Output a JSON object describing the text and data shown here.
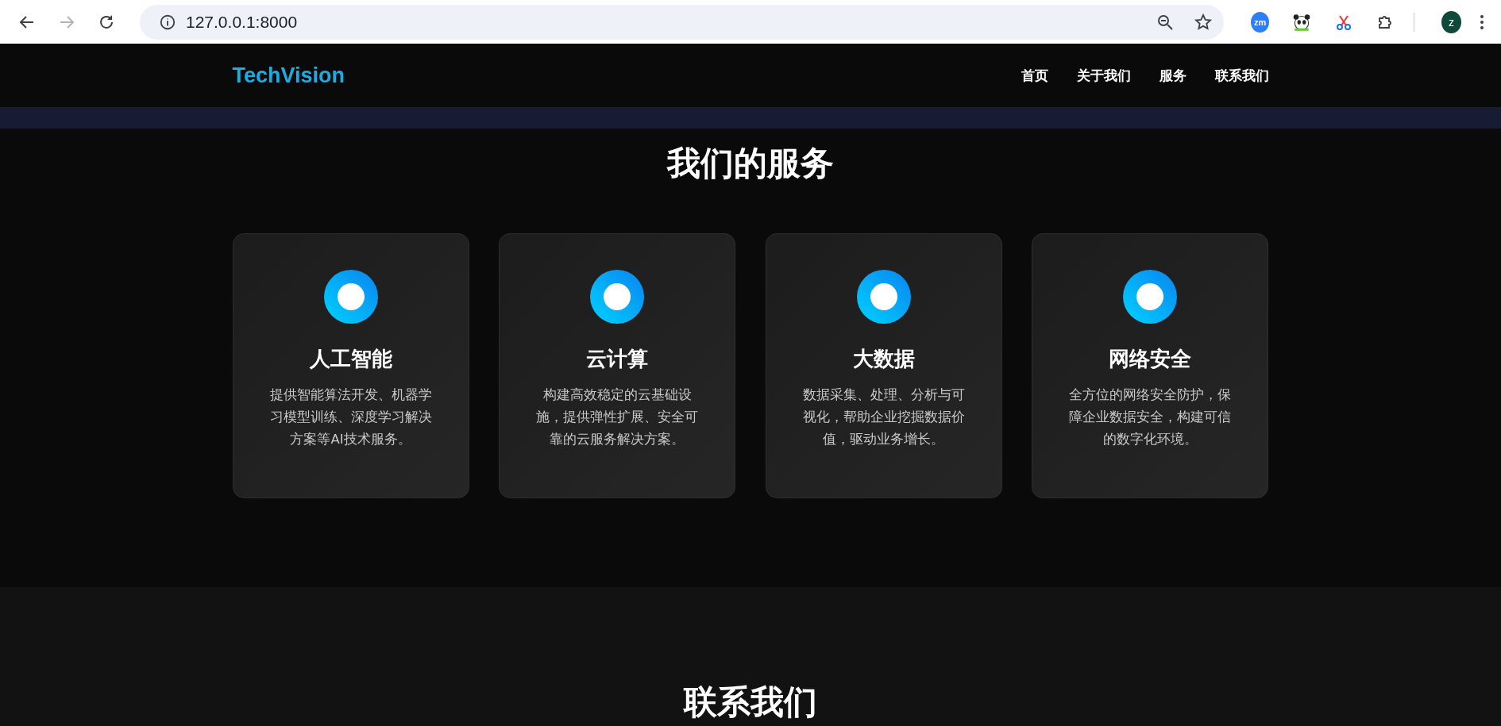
{
  "browser": {
    "nav_buttons": [
      {
        "kind": "back",
        "disabled": false
      },
      {
        "kind": "forward",
        "disabled": true
      },
      {
        "kind": "reload",
        "disabled": false
      }
    ],
    "url": "127.0.0.1:8000",
    "extensions": [
      {
        "kind": "badge",
        "label": "zm"
      },
      {
        "kind": "panda"
      },
      {
        "kind": "scissors"
      },
      {
        "kind": "puzzle"
      }
    ],
    "avatar": "z"
  },
  "header": {
    "logo": "TechVision",
    "nav": [
      "首页",
      "关于我们",
      "服务",
      "联系我们"
    ]
  },
  "services": {
    "title": "我们的服务",
    "cards": [
      {
        "title": "人工智能",
        "text": "提供智能算法开发、机器学习模型训练、深度学习解决方案等AI技术服务。"
      },
      {
        "title": "云计算",
        "text": "构建高效稳定的云基础设施，提供弹性扩展、安全可靠的云服务解决方案。"
      },
      {
        "title": "大数据",
        "text": "数据采集、处理、分析与可视化，帮助企业挖掘数据价值，驱动业务增长。"
      },
      {
        "title": "网络安全",
        "text": "全方位的网络安全防护，保障企业数据安全，构建可信的数字化环境。"
      }
    ]
  },
  "contact": {
    "title": "联系我们"
  }
}
